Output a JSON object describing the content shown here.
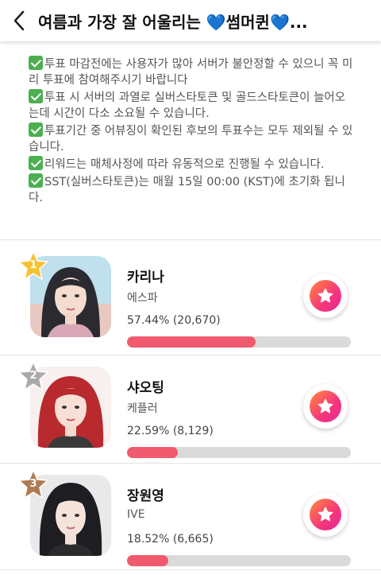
{
  "header": {
    "title": "여름과 가장 잘 어울리는 💙썸머퀸💙..."
  },
  "notices": [
    "투표 마감전에는 사용자가 많아 서버가 불안정할 수 있으니 꼭 미리 투표에 참여해주시기 바랍니다",
    "투표 시 서버의 과열로 실버스타토큰 및 골드스타토큰이 늘어오는데 시간이 다소 소요될 수 있습니다.",
    "투표기간 중 어뷰징이 확인된 후보의 투표수는 모두 제외될 수 있습니다.",
    "리워드는 매체사정에 따라 유동적으로 진행될 수 있습니다.",
    "SST(실버스타토큰)는 매월 15일 00:00 (KST)에 초기화 됩니다."
  ],
  "colors": {
    "check": "#4caf50",
    "bar_fill": "#ef5a6e",
    "bar_track": "#dadada",
    "rank_gold": "#f6c232",
    "rank_silver": "#a9a9a9",
    "rank_bronze": "#b07b52"
  },
  "candidates": [
    {
      "rank": "1",
      "name": "카리나",
      "group": "에스파",
      "percent_text": "57.44% (20,670)",
      "percent": 57.44,
      "badge_color": "#f6c232"
    },
    {
      "rank": "2",
      "name": "샤오팅",
      "group": "케플러",
      "percent_text": "22.59% (8,129)",
      "percent": 22.59,
      "badge_color": "#a9a9a9"
    },
    {
      "rank": "3",
      "name": "장원영",
      "group": "IVE",
      "percent_text": "18.52% (6,665)",
      "percent": 18.52,
      "badge_color": "#b07b52"
    }
  ],
  "icons": {
    "back": "chevron-left-icon",
    "vote": "star-icon"
  }
}
